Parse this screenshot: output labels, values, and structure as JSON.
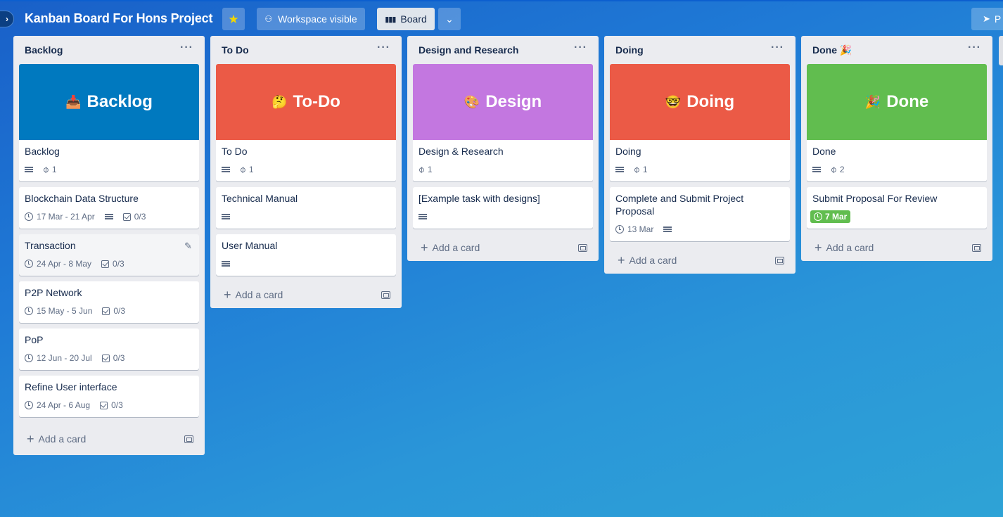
{
  "header": {
    "board_title": "Kanban Board For Hons Project",
    "workspace_label": "Workspace visible",
    "view_label": "Board",
    "right_label": "P"
  },
  "lists": [
    {
      "title": "Backlog",
      "cover": {
        "emoji": "📥",
        "text": "Backlog",
        "color": "#0079bf"
      },
      "cover_card": {
        "title": "Backlog",
        "attachments": "1"
      },
      "cards": [
        {
          "title": "Blockchain Data Structure",
          "dates": "17 Mar - 21 Apr",
          "checklist": "0/3"
        },
        {
          "title": "Transaction",
          "dates": "24 Apr - 8 May",
          "checklist": "0/3"
        },
        {
          "title": "P2P Network",
          "dates": "15 May - 5 Jun",
          "checklist": "0/3"
        },
        {
          "title": "PoP",
          "dates": "12 Jun - 20 Jul",
          "checklist": "0/3"
        },
        {
          "title": "Refine User interface",
          "dates": "24 Apr - 6 Aug",
          "checklist": "0/3"
        }
      ],
      "add_card": "Add a card"
    },
    {
      "title": "To Do",
      "cover": {
        "emoji": "🤔",
        "text": "To-Do",
        "color": "#eb5a46"
      },
      "cover_card": {
        "title": "To Do",
        "attachments": "1"
      },
      "cards": [
        {
          "title": "Technical Manual"
        },
        {
          "title": "User Manual"
        }
      ],
      "add_card": "Add a card"
    },
    {
      "title": "Design and Research",
      "cover": {
        "emoji": "🎨",
        "text": "Design",
        "color": "#c377e0"
      },
      "cover_card": {
        "title": "Design & Research",
        "attachments": "1"
      },
      "cards": [
        {
          "title": "[Example task with designs]"
        }
      ],
      "add_card": "Add a card"
    },
    {
      "title": "Doing",
      "cover": {
        "emoji": "🤓",
        "text": "Doing",
        "color": "#eb5a46"
      },
      "cover_card": {
        "title": "Doing",
        "attachments": "1"
      },
      "cards": [
        {
          "title": "Complete and Submit Project Proposal",
          "dates": "13 Mar"
        }
      ],
      "add_card": "Add a card"
    },
    {
      "title": "Done 🎉",
      "cover": {
        "emoji": "🎉",
        "text": "Done",
        "color": "#61bd4f"
      },
      "cover_card": {
        "title": "Done",
        "attachments": "2"
      },
      "cards": [
        {
          "title": "Submit Proposal For Review",
          "due": "7 Mar"
        }
      ],
      "add_card": "Add a card"
    }
  ]
}
